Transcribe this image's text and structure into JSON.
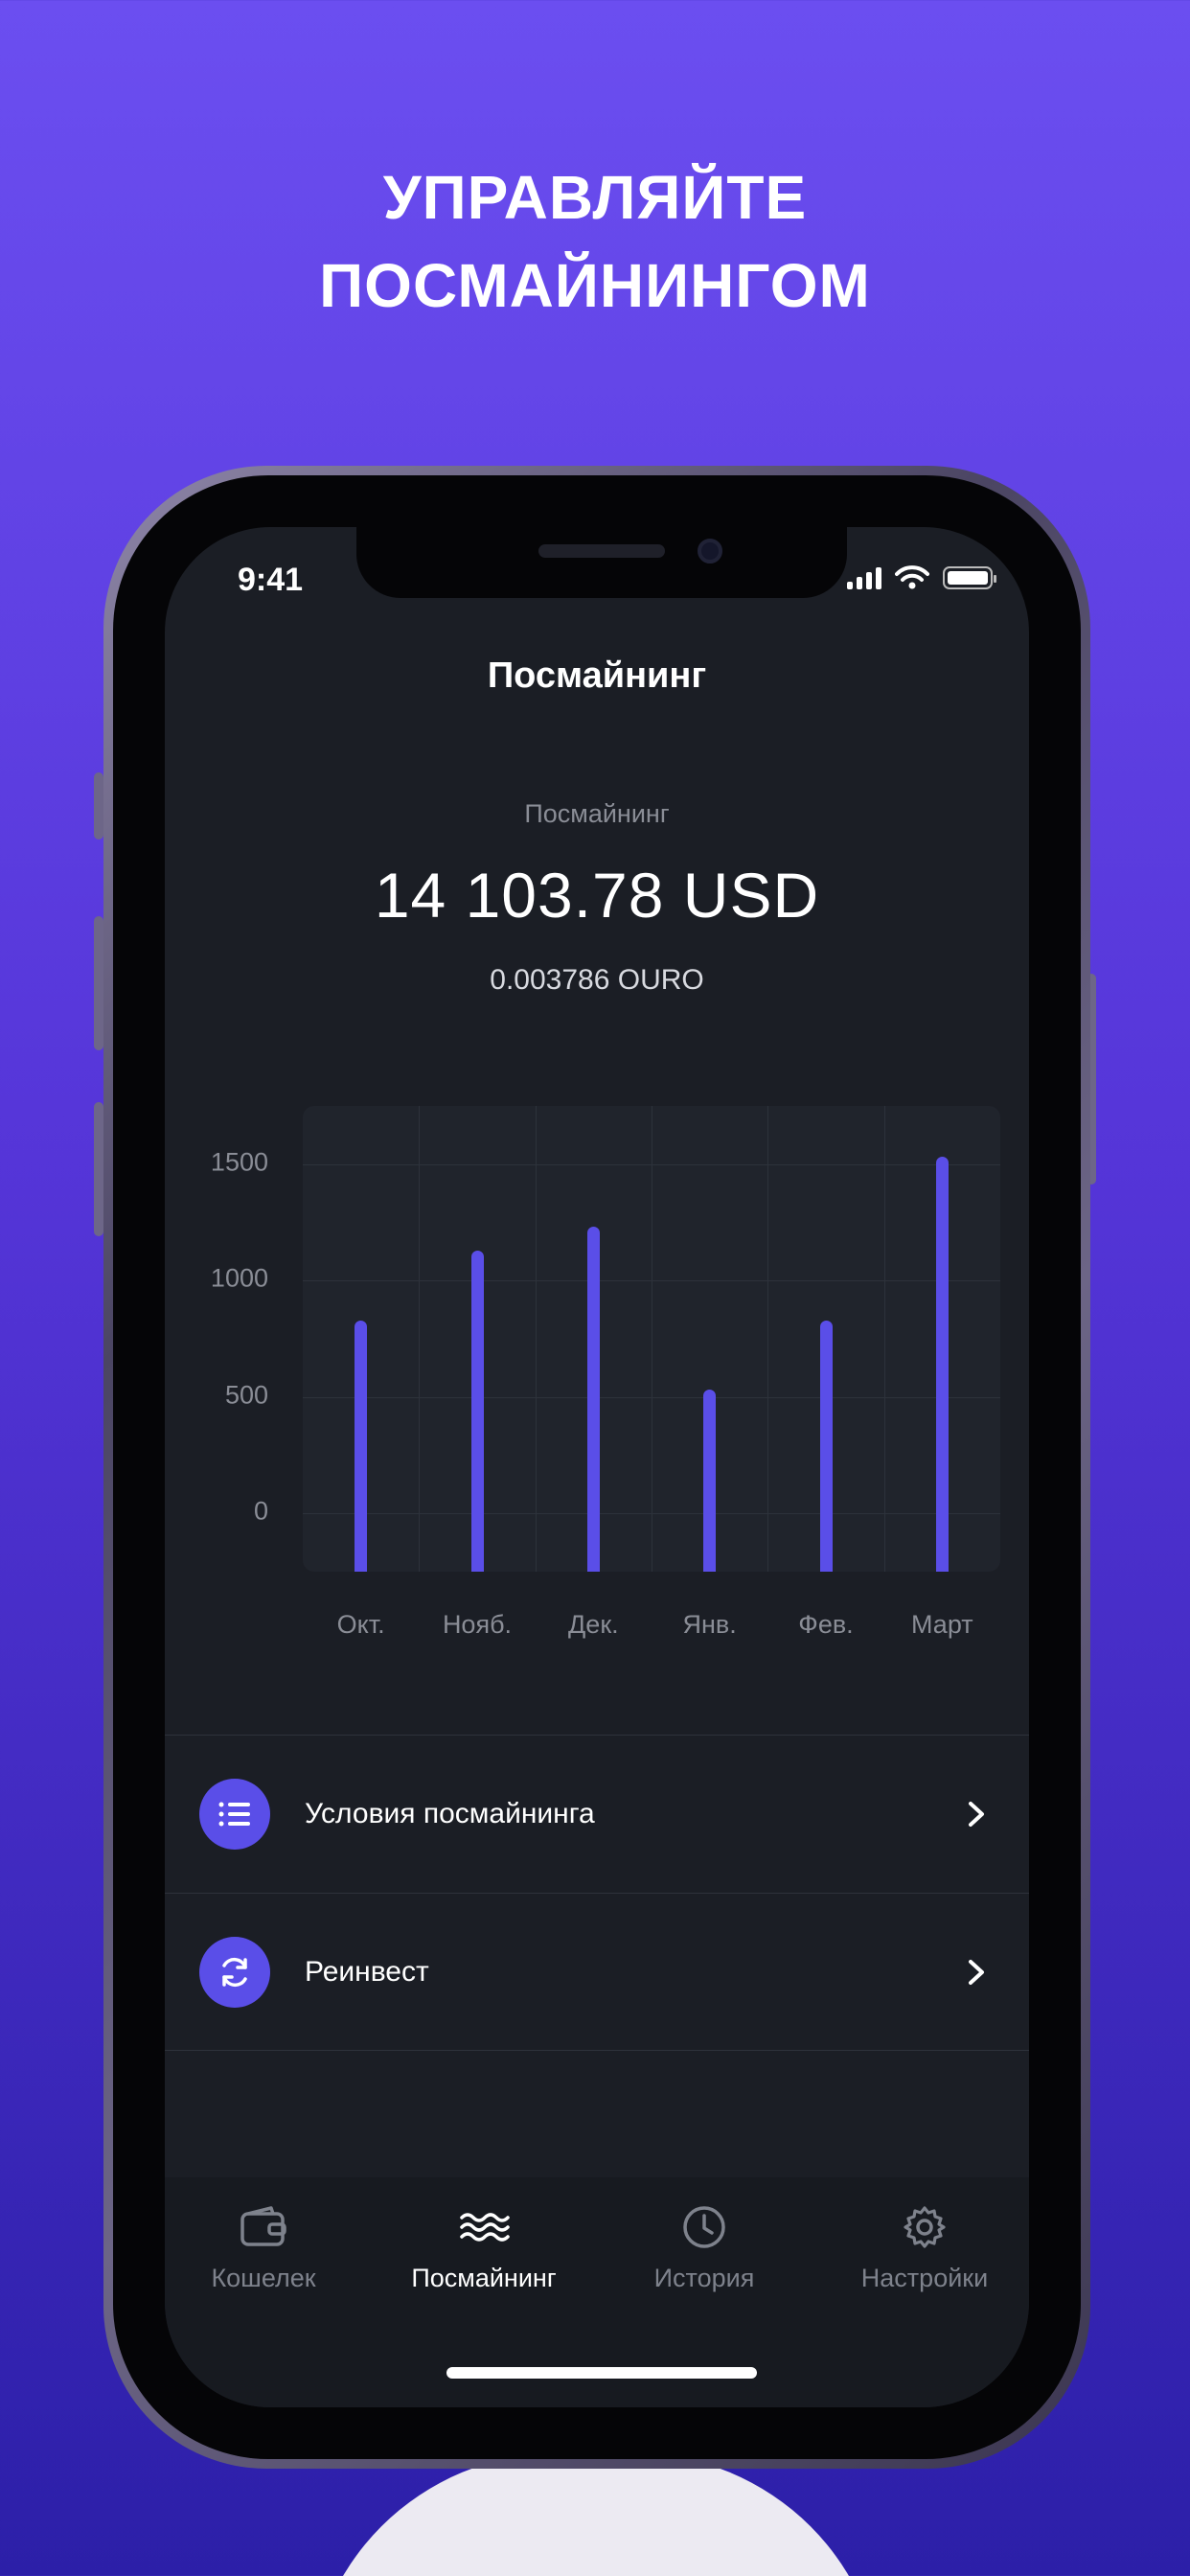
{
  "promo": {
    "line1": "УПРАВЛЯЙТЕ",
    "line2": "ПОСМАЙНИНГОМ"
  },
  "status_bar": {
    "time": "9:41"
  },
  "nav": {
    "title": "Посмайнинг"
  },
  "balance": {
    "label": "Посмайнинг",
    "usd": "14 103.78 USD",
    "ouro": "0.003786 OURO"
  },
  "colors": {
    "accent": "#5a4ee8",
    "background": "#1b1e25"
  },
  "chart_data": {
    "type": "bar",
    "categories": [
      "Окт.",
      "Нояб.",
      "Дек.",
      "Янв.",
      "Фев.",
      "Март"
    ],
    "values": [
      830,
      1130,
      1230,
      530,
      830,
      1530
    ],
    "yticks": [
      "0",
      "500",
      "1000",
      "1500"
    ],
    "ylim": [
      -250,
      1750
    ]
  },
  "menu": {
    "items": [
      {
        "label": "Условия посмайнинга",
        "icon": "list-icon"
      },
      {
        "label": "Реинвест",
        "icon": "refresh-icon"
      }
    ]
  },
  "tabs": [
    {
      "label": "Кошелек",
      "icon": "wallet-icon"
    },
    {
      "label": "Посмайнинг",
      "icon": "waves-icon",
      "active": true
    },
    {
      "label": "История",
      "icon": "clock-icon"
    },
    {
      "label": "Настройки",
      "icon": "gear-icon"
    }
  ]
}
